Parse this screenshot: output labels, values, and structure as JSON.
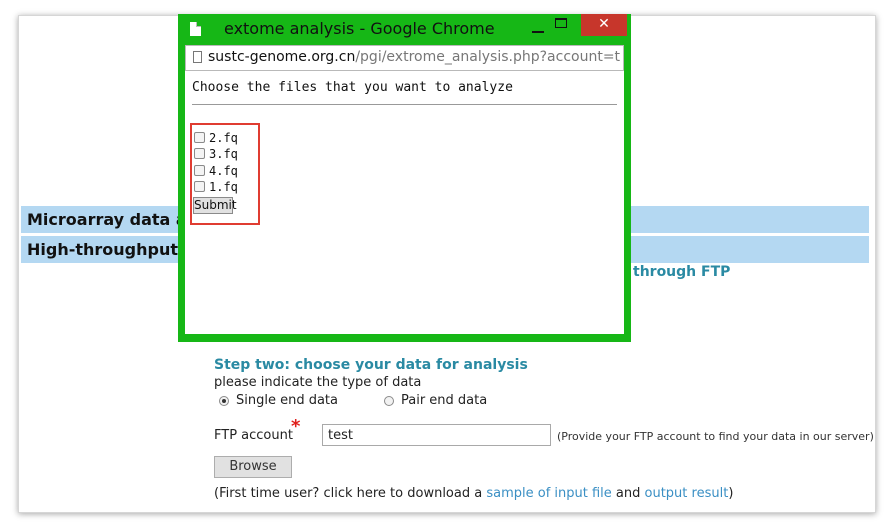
{
  "page": {
    "bands": [
      "Microarray data an",
      "High-throughput se"
    ],
    "ftp_link": "through FTP",
    "step_title": "Step two: choose your data for analysis",
    "indicate_text": "please indicate the type of data",
    "radio_options": [
      {
        "label": "Single end data",
        "checked": true
      },
      {
        "label": "Pair end data",
        "checked": false
      }
    ],
    "ftp_label": "FTP account",
    "required_mark": "*",
    "ftp_value": "test",
    "ftp_hint": "(Provide your FTP account to find your data in our server)",
    "browse_label": "Browse",
    "first_time": {
      "prefix": "(First time user? click here to download a ",
      "link1": "sample of input file",
      "middle": " and ",
      "link2": "output result",
      "suffix": ")"
    }
  },
  "popup": {
    "title": "extome analysis - Google Chrome",
    "close_glyph": "✕",
    "url_host": "sustc-genome.org.cn",
    "url_path": "/pgi/extrome_analysis.php?account=test",
    "heading": "Choose the files that you want to analyze",
    "files": [
      "2.fq",
      "3.fq",
      "4.fq",
      "1.fq"
    ],
    "submit_label": "Submit",
    "window_color": "#16b716",
    "highlight_color": "#e03c31"
  }
}
